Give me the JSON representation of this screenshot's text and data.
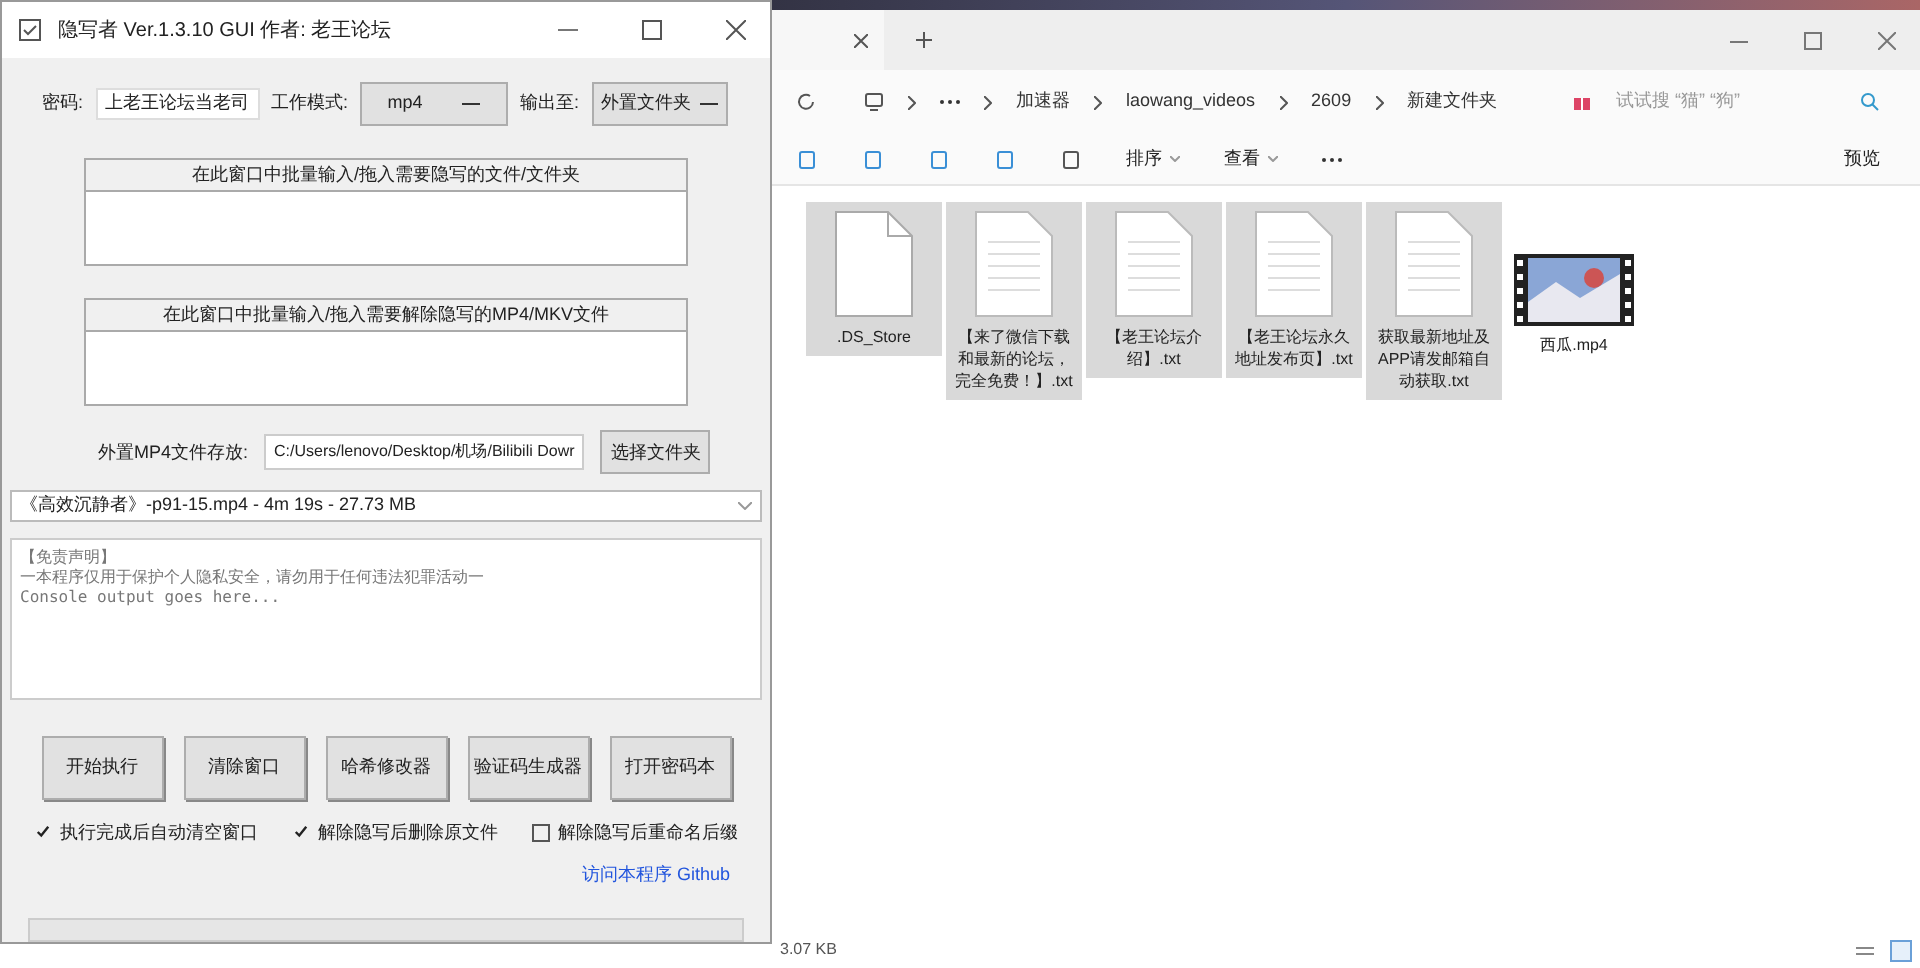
{
  "app_window": {
    "title": "隐写者 Ver.1.3.10 GUI 作者: 老王论坛",
    "password_label": "密码:",
    "password_value": "上老王论坛当老司",
    "mode_label": "工作模式:",
    "mode_value": "mp4",
    "output_label": "输出至:",
    "output_value": "外置文件夹",
    "hide_panel_title": "在此窗口中批量输入/拖入需要隐写的文件/文件夹",
    "reveal_panel_title": "在此窗口中批量输入/拖入需要解除隐写的MP4/MKV文件",
    "folder_label": "外置MP4文件存放:",
    "folder_value": "C:/Users/lenovo/Desktop/机场/Bilibili Dowr",
    "folder_button": "选择文件夹",
    "video_select": "《高效沉静者》-p91-15.mp4 - 4m 19s - 27.73 MB",
    "console_lines": [
      "【免责声明】",
      "一本程序仅用于保护个人隐私安全，请勿用于任何违法犯罪活动一",
      "Console output goes here..."
    ],
    "buttons": [
      "开始执行",
      "清除窗口",
      "哈希修改器",
      "验证码生成器",
      "打开密码本"
    ],
    "options": [
      {
        "label": "执行完成后自动清空窗口",
        "checked": true
      },
      {
        "label": "解除隐写后删除原文件",
        "checked": true
      },
      {
        "label": "解除隐写后重命名后缀",
        "checked": false
      }
    ],
    "link": "访问本程序 Github",
    "progress": {
      "level": 0
    }
  },
  "explorer": {
    "breadcrumb": [
      "加速器",
      "laowang_videos",
      "2609",
      "新建文件夹"
    ],
    "search_placeholder": "试试搜 “猫” “狗”",
    "toolbar": [
      "排序",
      "查看"
    ],
    "preview": "预览",
    "files": [
      {
        "name": ".DS_Store",
        "kind": "blank",
        "selected": true
      },
      {
        "name": "【来了微信下载和最新的论坛，完全免费！】.txt",
        "kind": "text",
        "selected": true
      },
      {
        "name": "【老王论坛介绍】.txt",
        "kind": "text",
        "selected": true
      },
      {
        "name": "【老王论坛永久地址发布页】.txt",
        "kind": "text",
        "selected": true
      },
      {
        "name": "获取最新地址及APP请发邮箱自动获取.txt",
        "kind": "text",
        "selected": true
      },
      {
        "name": "西瓜.mp4",
        "kind": "video",
        "selected": false
      }
    ],
    "status": "3.07 KB"
  }
}
